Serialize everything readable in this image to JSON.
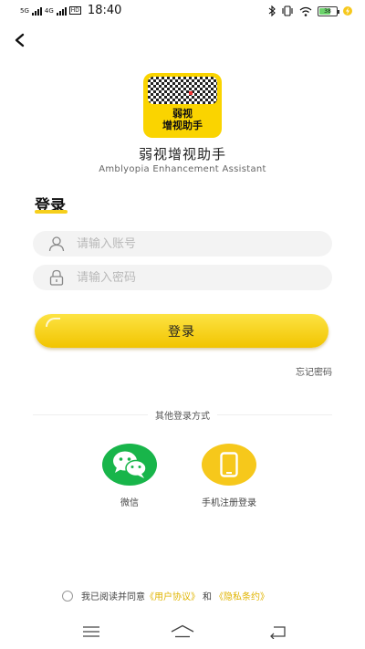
{
  "status_bar": {
    "net1": "5G",
    "net2": "4G",
    "hd": "HD",
    "time": "18:40",
    "battery": "38"
  },
  "logo": {
    "line1": "弱视",
    "line2": "增视助手"
  },
  "app": {
    "name": "弱视增视助手",
    "subtitle": "Amblyopia Enhancement Assistant"
  },
  "login": {
    "title": "登录",
    "account_placeholder": "请输入账号",
    "password_placeholder": "请输入密码",
    "button_label": "登录",
    "forgot_password": "忘记密码"
  },
  "other_login": {
    "heading": "其他登录方式",
    "wechat_label": "微信",
    "phone_label": "手机注册登录"
  },
  "agreement": {
    "prefix": "我已阅读并同意",
    "user_agreement": "《用户协议》",
    "and": "和",
    "privacy": "《隐私条约》"
  },
  "colors": {
    "accent": "#f6c81b",
    "wechat": "#18b54a"
  }
}
